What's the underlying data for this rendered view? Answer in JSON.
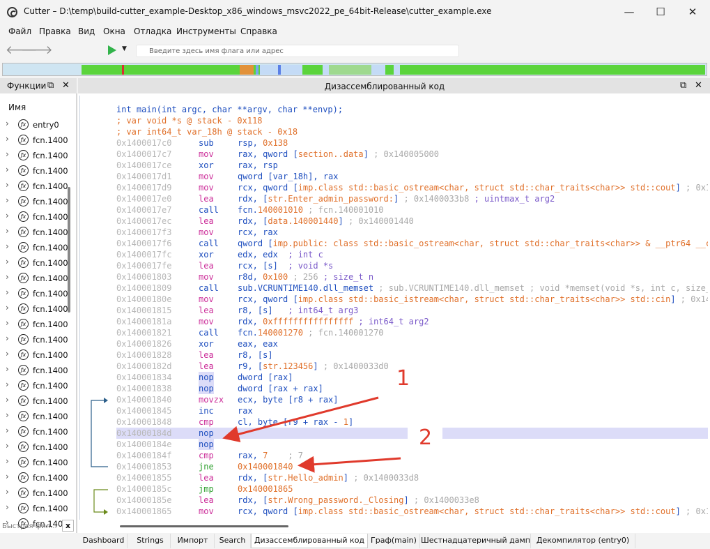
{
  "window": {
    "title": "Cutter – D:\\temp\\build-cutter_example-Desktop_x86_windows_msvc2022_pe_64bit-Release\\cutter_example.exe"
  },
  "window_controls": {
    "minimize": "—",
    "maximize": "☐",
    "close": "✕"
  },
  "menu": [
    "Файл",
    "Правка",
    "Вид",
    "Окна",
    "Отладка",
    "Инструменты",
    "Справка"
  ],
  "toolbar": {
    "back_icon": "back-arrow-icon",
    "forward_icon": "forward-arrow-icon",
    "run_icon": "play-icon",
    "flag_placeholder": "Введите здесь имя флага или адрес"
  },
  "navbar": {
    "segments": [
      {
        "color": "#5bd43c",
        "w": 6.5
      },
      {
        "color": "#d93030",
        "w": 0.3
      },
      {
        "color": "#5bd43c",
        "w": 18.5
      },
      {
        "color": "#e2923a",
        "w": 2.2
      },
      {
        "color": "#5bd43c",
        "w": 0.4
      },
      {
        "color": "#7aa6ee",
        "w": 0.4
      },
      {
        "color": "#5bd43c",
        "w": 0.2
      },
      {
        "color": "#c4dbf6",
        "w": 3.0
      },
      {
        "color": "#5a7fe6",
        "w": 0.4
      },
      {
        "color": "#c4dbf6",
        "w": 3.5
      },
      {
        "color": "#5bd43c",
        "w": 3.2
      },
      {
        "color": "#c4dbf6",
        "w": 1.0
      },
      {
        "color": "#9fd98f",
        "w": 6.8
      },
      {
        "color": "#c4dbf6",
        "w": 2.2
      },
      {
        "color": "#5bd43c",
        "w": 1.4
      },
      {
        "color": "#c4dbf6",
        "w": 1.0
      },
      {
        "color": "#5bd43c",
        "w": 48.8
      }
    ]
  },
  "functions_panel": {
    "title": "Функции",
    "float_icon": "⧉",
    "close_icon": "✕",
    "column_header": "Имя",
    "items": [
      "entry0",
      "fcn.1400",
      "fcn.1400",
      "fcn.1400",
      "fcn.1400",
      "fcn.1400",
      "fcn.1400",
      "fcn.1400",
      "fcn.1400",
      "fcn.1400",
      "fcn.1400",
      "fcn.1400",
      "fcn.1400",
      "fcn.1400",
      "fcn.1400",
      "fcn.1400",
      "fcn.1400",
      "fcn.1400",
      "fcn.1400",
      "fcn.1400",
      "fcn.1400",
      "fcn.1400",
      "fcn.1400",
      "fcn.1400",
      "fcn.1400",
      "fcn.1400",
      "fcn.1400"
    ],
    "fn_glyph": "ƒx",
    "chevron": "›",
    "filter_placeholder": "Быстрая фил...",
    "filter_clear": "x"
  },
  "disasm_panel": {
    "title": "Дизассемблированный код",
    "float_icon": "⧉",
    "close_icon": "✕",
    "header_lines": [
      {
        "text": "int main(int argc, char **argv, char **envp);",
        "color": "#1f4fbf"
      },
      {
        "text": "; var void *s @ stack - 0x118",
        "color": "#e0702a"
      },
      {
        "text": "; var int64_t var_18h @ stack - 0x18",
        "color": "#e0702a"
      }
    ],
    "rows": [
      {
        "addr": "0x1400017c0",
        "mn": "sub",
        "mc": "#1f4fbf",
        "ops": [
          [
            "rsp, ",
            "#1f4fbf"
          ],
          [
            "0x138",
            "#e0702a"
          ]
        ]
      },
      {
        "addr": "0x1400017c7",
        "mn": "mov",
        "mc": "#cc2f9a",
        "ops": [
          [
            "rax, qword [",
            "#1f4fbf"
          ],
          [
            "section..data",
            "#e0702a"
          ],
          [
            "] ",
            "#1f4fbf"
          ],
          [
            "; 0x140005000",
            "#a8a8a8"
          ]
        ]
      },
      {
        "addr": "0x1400017ce",
        "mn": "xor",
        "mc": "#1f4fbf",
        "ops": [
          [
            "rax, rsp",
            "#1f4fbf"
          ]
        ]
      },
      {
        "addr": "0x1400017d1",
        "mn": "mov",
        "mc": "#cc2f9a",
        "ops": [
          [
            "qword [var_18h], rax",
            "#1f4fbf"
          ]
        ]
      },
      {
        "addr": "0x1400017d9",
        "mn": "mov",
        "mc": "#cc2f9a",
        "ops": [
          [
            "rcx, qword [",
            "#1f4fbf"
          ],
          [
            "imp.class std::basic_ostream<char, struct std::char_traits<char>> std::cout",
            "#e0702a"
          ],
          [
            "] ",
            "#1f4fbf"
          ],
          [
            "; 0x1400",
            "#a8a8a8"
          ]
        ]
      },
      {
        "addr": "0x1400017e0",
        "mn": "lea",
        "mc": "#cc2f9a",
        "ops": [
          [
            "rdx, [",
            "#1f4fbf"
          ],
          [
            "str.Enter_admin_password:",
            "#e0702a"
          ],
          [
            "] ",
            "#1f4fbf"
          ],
          [
            "; 0x1400033b8 ",
            "#a8a8a8"
          ],
          [
            "; uintmax_t arg2",
            "#7a59c9"
          ]
        ]
      },
      {
        "addr": "0x1400017e7",
        "mn": "call",
        "mc": "#1f4fbf",
        "ops": [
          [
            "fcn.",
            "#1f4fbf"
          ],
          [
            "140001010",
            "#e0702a"
          ],
          [
            " ; fcn.140001010",
            "#a8a8a8"
          ]
        ]
      },
      {
        "addr": "0x1400017ec",
        "mn": "lea",
        "mc": "#cc2f9a",
        "ops": [
          [
            "rdx, [",
            "#1f4fbf"
          ],
          [
            "data.140001440",
            "#e0702a"
          ],
          [
            "] ",
            "#1f4fbf"
          ],
          [
            "; 0x140001440",
            "#a8a8a8"
          ]
        ]
      },
      {
        "addr": "0x1400017f3",
        "mn": "mov",
        "mc": "#cc2f9a",
        "ops": [
          [
            "rcx, rax",
            "#1f4fbf"
          ]
        ]
      },
      {
        "addr": "0x1400017f6",
        "mn": "call",
        "mc": "#1f4fbf",
        "ops": [
          [
            "qword [",
            "#1f4fbf"
          ],
          [
            "imp.public: class std::basic_ostream<char, struct std::char_traits<char>> & __ptr64 __cdecl",
            "#e0702a"
          ]
        ]
      },
      {
        "addr": "0x1400017fc",
        "mn": "xor",
        "mc": "#1f4fbf",
        "ops": [
          [
            "edx, edx",
            "#1f4fbf"
          ],
          [
            "  ; int c",
            "#7a59c9"
          ]
        ]
      },
      {
        "addr": "0x1400017fe",
        "mn": "lea",
        "mc": "#cc2f9a",
        "ops": [
          [
            "rcx, [s]",
            "#1f4fbf"
          ],
          [
            "  ; void *s",
            "#7a59c9"
          ]
        ]
      },
      {
        "addr": "0x140001803",
        "mn": "mov",
        "mc": "#cc2f9a",
        "ops": [
          [
            "r8d, ",
            "#1f4fbf"
          ],
          [
            "0x100",
            "#e0702a"
          ],
          [
            " ; 256 ",
            "#a8a8a8"
          ],
          [
            "; size_t n",
            "#7a59c9"
          ]
        ]
      },
      {
        "addr": "0x140001809",
        "mn": "call",
        "mc": "#1f4fbf",
        "ops": [
          [
            "sub.VCRUNTIME140.dll_memset",
            "#1f4fbf"
          ],
          [
            " ; sub.VCRUNTIME140.dll_memset ; void *memset(void *s, int c, size_t n",
            "#a8a8a8"
          ]
        ]
      },
      {
        "addr": "0x14000180e",
        "mn": "mov",
        "mc": "#cc2f9a",
        "ops": [
          [
            "rcx, qword [",
            "#1f4fbf"
          ],
          [
            "imp.class std::basic_istream<char, struct std::char_traits<char>> std::cin",
            "#e0702a"
          ],
          [
            "] ",
            "#1f4fbf"
          ],
          [
            "; 0x14000",
            "#a8a8a8"
          ]
        ]
      },
      {
        "addr": "0x140001815",
        "mn": "lea",
        "mc": "#cc2f9a",
        "ops": [
          [
            "r8, [s]",
            "#1f4fbf"
          ],
          [
            "   ; int64_t arg3",
            "#7a59c9"
          ]
        ]
      },
      {
        "addr": "0x14000181a",
        "mn": "mov",
        "mc": "#cc2f9a",
        "ops": [
          [
            "rdx, ",
            "#1f4fbf"
          ],
          [
            "0xffffffffffffffff",
            "#e0702a"
          ],
          [
            " ; int64_t arg2",
            "#7a59c9"
          ]
        ]
      },
      {
        "addr": "0x140001821",
        "mn": "call",
        "mc": "#1f4fbf",
        "ops": [
          [
            "fcn.",
            "#1f4fbf"
          ],
          [
            "140001270",
            "#e0702a"
          ],
          [
            " ; fcn.140001270",
            "#a8a8a8"
          ]
        ]
      },
      {
        "addr": "0x140001826",
        "mn": "xor",
        "mc": "#1f4fbf",
        "ops": [
          [
            "eax, eax",
            "#1f4fbf"
          ]
        ]
      },
      {
        "addr": "0x140001828",
        "mn": "lea",
        "mc": "#cc2f9a",
        "ops": [
          [
            "r8, [s]",
            "#1f4fbf"
          ]
        ]
      },
      {
        "addr": "0x14000182d",
        "mn": "lea",
        "mc": "#cc2f9a",
        "ops": [
          [
            "r9, [",
            "#1f4fbf"
          ],
          [
            "str.123456",
            "#e0702a"
          ],
          [
            "] ",
            "#1f4fbf"
          ],
          [
            "; 0x1400033d0",
            "#a8a8a8"
          ]
        ]
      },
      {
        "addr": "0x140001834",
        "mn": "nop",
        "mc": "#1f4fbf",
        "mbg": "#dcdcf8",
        "ops": [
          [
            "dword [rax]",
            "#1f4fbf"
          ]
        ]
      },
      {
        "addr": "0x140001838",
        "mn": "nop",
        "mc": "#1f4fbf",
        "mbg": "#dcdcf8",
        "ops": [
          [
            "dword [rax + rax]",
            "#1f4fbf"
          ]
        ]
      },
      {
        "addr": "0x140001840",
        "mn": "movzx",
        "mc": "#cc2f9a",
        "ops": [
          [
            "ecx, byte [r8 + rax]",
            "#1f4fbf"
          ]
        ]
      },
      {
        "addr": "0x140001845",
        "mn": "inc",
        "mc": "#1f4fbf",
        "ops": [
          [
            "rax",
            "#1f4fbf"
          ]
        ]
      },
      {
        "addr": "0x140001848",
        "mn": "cmp",
        "mc": "#cc2f9a",
        "ops": [
          [
            "cl, byte [r9 + rax - ",
            "#1f4fbf"
          ],
          [
            "1",
            "#e0702a"
          ],
          [
            "]",
            "#1f4fbf"
          ]
        ]
      },
      {
        "addr": "0x14000184d",
        "mn": "nop",
        "mc": "#1f4fbf",
        "bg": "#dcdcf8",
        "ops": []
      },
      {
        "addr": "0x14000184e",
        "mn": "nop",
        "mc": "#1f4fbf",
        "mbg": "#dcdcf8",
        "ops": []
      },
      {
        "addr": "0x14000184f",
        "mn": "cmp",
        "mc": "#cc2f9a",
        "ops": [
          [
            "rax, ",
            "#1f4fbf"
          ],
          [
            "7",
            "#e0702a"
          ],
          [
            "    ; 7",
            "#a8a8a8"
          ]
        ]
      },
      {
        "addr": "0x140001853",
        "mn": "jne",
        "mc": "#2fa02f",
        "ops": [
          [
            "0x140001840",
            "#e0702a"
          ]
        ]
      },
      {
        "addr": "0x140001855",
        "mn": "lea",
        "mc": "#cc2f9a",
        "ops": [
          [
            "rdx, [",
            "#1f4fbf"
          ],
          [
            "str.Hello_admin",
            "#e0702a"
          ],
          [
            "] ",
            "#1f4fbf"
          ],
          [
            "; 0x1400033d8",
            "#a8a8a8"
          ]
        ]
      },
      {
        "addr": "0x14000185c",
        "mn": "jmp",
        "mc": "#2fa02f",
        "ops": [
          [
            "0x140001865",
            "#e0702a"
          ]
        ]
      },
      {
        "addr": "0x14000185e",
        "mn": "lea",
        "mc": "#cc2f9a",
        "ops": [
          [
            "rdx, [",
            "#1f4fbf"
          ],
          [
            "str.Wrong_password._Closing",
            "#e0702a"
          ],
          [
            "] ",
            "#1f4fbf"
          ],
          [
            "; 0x1400033e8",
            "#a8a8a8"
          ]
        ]
      },
      {
        "addr": "0x140001865",
        "mn": "mov",
        "mc": "#cc2f9a",
        "ops": [
          [
            "rcx, qword [",
            "#1f4fbf"
          ],
          [
            "imp.class std::basic_ostream<char, struct std::char_traits<char>> std::cout",
            "#e0702a"
          ],
          [
            "] ",
            "#1f4fbf"
          ],
          [
            "; 0x1400",
            "#a8a8a8"
          ]
        ]
      }
    ]
  },
  "annotations": {
    "label1": "1",
    "label2": "2"
  },
  "tabs": [
    "Dashboard",
    "Strings",
    "Импорт",
    "Search",
    "Дизассемблированный код",
    "Граф(main)",
    "Шестнадцатеричный дамп",
    "Декомпилятор (entry0)"
  ],
  "active_tab": 4
}
